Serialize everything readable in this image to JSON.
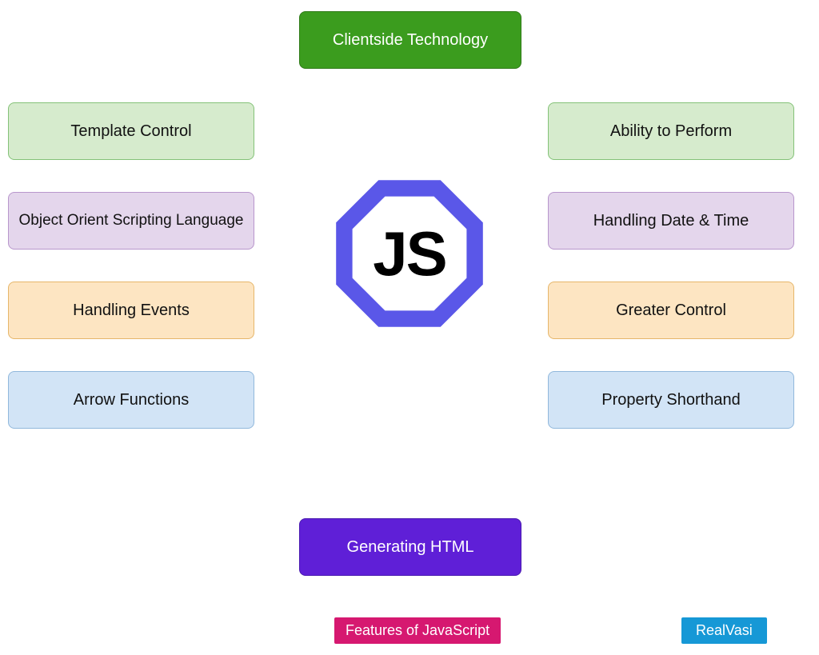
{
  "top": {
    "label": "Clientside Technology"
  },
  "bottom": {
    "label": "Generating HTML"
  },
  "left": [
    {
      "label": "Template Control"
    },
    {
      "label": "Object Orient Scripting Language"
    },
    {
      "label": "Handling Events"
    },
    {
      "label": "Arrow Functions"
    }
  ],
  "right": [
    {
      "label": "Ability to Perform"
    },
    {
      "label": "Handling Date & Time"
    },
    {
      "label": "Greater Control"
    },
    {
      "label": "Property Shorthand"
    }
  ],
  "center": {
    "label": "JS"
  },
  "footer": {
    "title": "Features of JavaScript",
    "brand": "RealVasi"
  },
  "colors": {
    "green_header": "#3b9c1e",
    "purple_footer": "#5f1fd7",
    "light_green": "#d6ebcd",
    "light_purple": "#e4d6ec",
    "light_orange": "#fde5c2",
    "light_blue": "#d2e4f6",
    "octagon_blue": "#5a57e8",
    "pink": "#d61870",
    "cyan": "#1698d6"
  }
}
